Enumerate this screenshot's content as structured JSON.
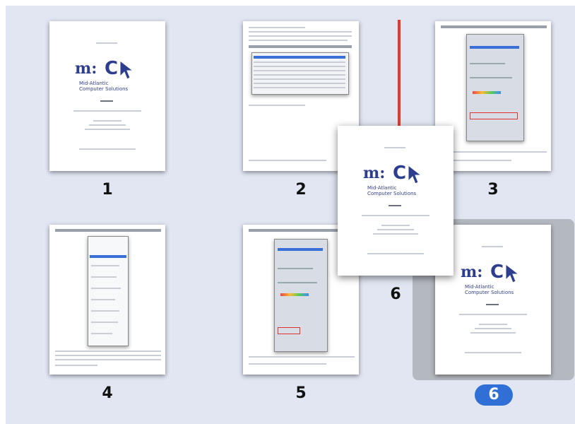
{
  "thumbnails": [
    {
      "number": "1"
    },
    {
      "number": "2"
    },
    {
      "number": "3"
    },
    {
      "number": "4"
    },
    {
      "number": "5"
    },
    {
      "number": "6",
      "selected": true
    }
  ],
  "drag_preview": {
    "number": "6"
  },
  "logo": {
    "mark_m": "m:",
    "mark_c": "C",
    "line1": "Mid-Atlantic",
    "line2": "Computer Solutions"
  },
  "colors": {
    "workspace_bg": "#e1e6f2",
    "selection_bg": "#b4b8bf",
    "selection_badge": "#2f6fd6",
    "insertion_marker": "#e8382a",
    "logo_blue": "#2d3e8f"
  },
  "icons": {
    "insertion": "insertion-marker",
    "cursor": "cursor-arrow-icon"
  }
}
